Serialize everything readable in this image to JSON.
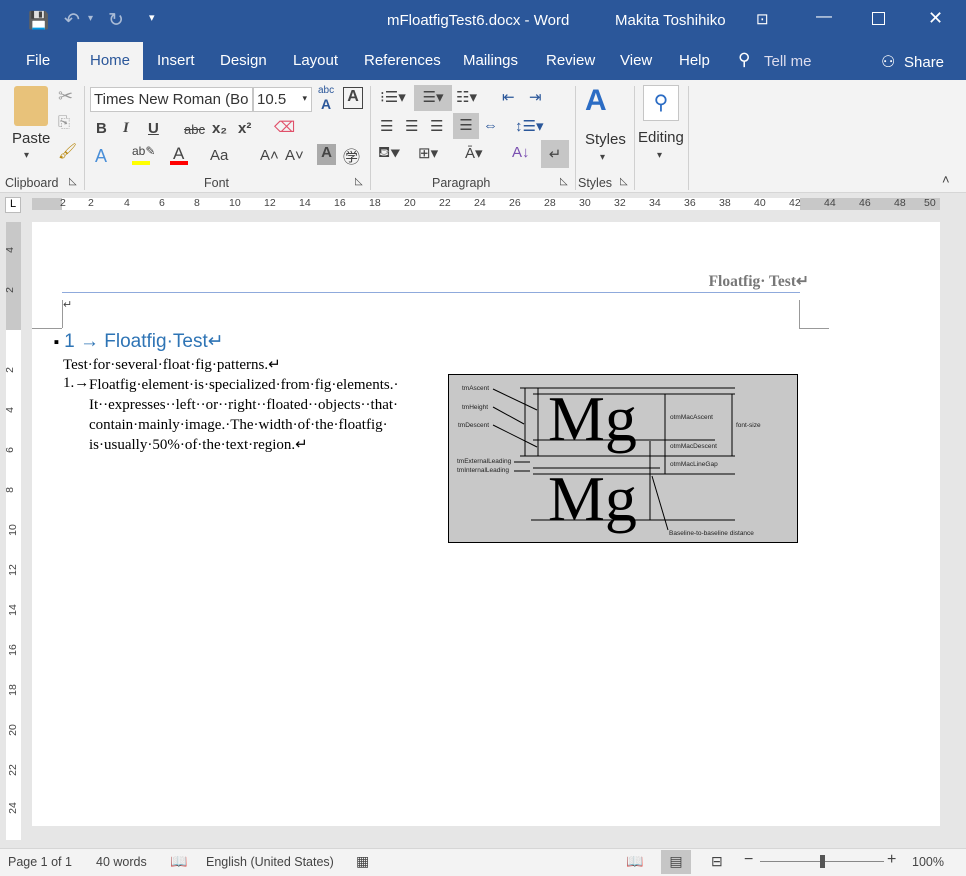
{
  "titlebar": {
    "title": "mFloatfigTest6.docx  -  Word",
    "user": "Makita Toshihiko",
    "icons": [
      "save-icon",
      "undo-icon",
      "redo-icon",
      "customize-qat-icon",
      "ribbon-display-icon",
      "minimize-icon",
      "maximize-icon",
      "close-icon"
    ]
  },
  "tabs": [
    {
      "label": "File"
    },
    {
      "label": "Home"
    },
    {
      "label": "Insert"
    },
    {
      "label": "Design"
    },
    {
      "label": "Layout"
    },
    {
      "label": "References"
    },
    {
      "label": "Mailings"
    },
    {
      "label": "Review"
    },
    {
      "label": "View"
    },
    {
      "label": "Help"
    }
  ],
  "tell_me": "Tell me",
  "share": "Share",
  "ribbon": {
    "paste": "Paste",
    "font_name": "Times New Roman (Bo",
    "font_size": "10.5",
    "styles": "Styles",
    "editing": "Editing",
    "groups": {
      "clipboard": "Clipboard",
      "font": "Font",
      "paragraph": "Paragraph",
      "styles": "Styles"
    },
    "highlight_color": "#ffff00",
    "font_color": "#ff0000"
  },
  "ruler_labels": [
    "2",
    "2",
    "4",
    "6",
    "8",
    "10",
    "12",
    "14",
    "16",
    "18",
    "20",
    "22",
    "24",
    "26",
    "28",
    "30",
    "32",
    "34",
    "36",
    "38",
    "40",
    "42",
    "44",
    "46",
    "48",
    "50"
  ],
  "vruler_labels": [
    "4",
    "2",
    "",
    "2",
    "4",
    "6",
    "8",
    "10",
    "12",
    "14",
    "16",
    "18",
    "20",
    "22",
    "24"
  ],
  "document": {
    "header": "Floatfig· Test↵",
    "empty_para": "↵",
    "heading_num": "1 →",
    "heading": "Floatfig·Test↵",
    "intro": "Test·for·several·float·fig·patterns.↵",
    "list_num": "1.→",
    "list_lines": [
      "Floatfig·element·is·specialized·from·fig·elements.·",
      "It··expresses··left··or··right··floated··objects··that·",
      "contain·mainly·image.·The·width·of·the·floatfig·",
      "is·usually·50%·of·the·text·region.↵"
    ],
    "figure": {
      "glyphs": "Mg",
      "labels": {
        "tmAscent": "tmAscent",
        "tmHeight": "tmHeight",
        "tmDescent": "tmDescent",
        "tmExternalLeading": "tmExternalLeading",
        "tmInternalLeading": "tmInternalLeading",
        "otmMacAscent": "otmMacAscent",
        "otmMacDescent": "otmMacDescent",
        "otmMacLineGap": "otmMacLineGap",
        "fontSize": "font-size",
        "baseline": "Baseline-to-baseline distance"
      }
    }
  },
  "status": {
    "page": "Page 1 of 1",
    "words": "40 words",
    "language": "English (United States)",
    "zoom": "100%",
    "zoom_level": 100
  }
}
